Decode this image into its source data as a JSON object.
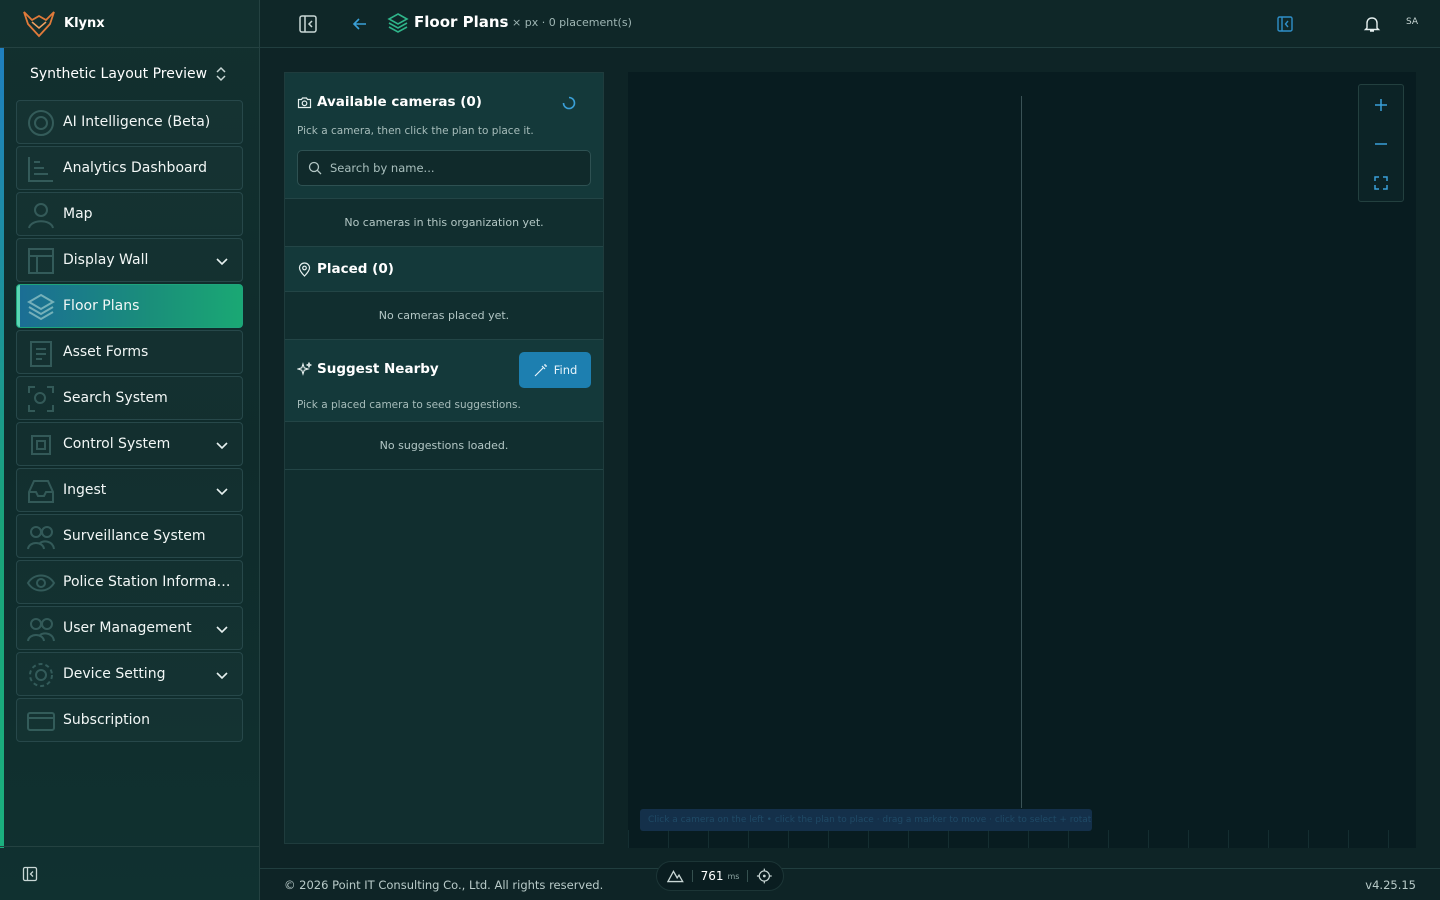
{
  "app": {
    "name": "Klynx"
  },
  "org": {
    "name": "Synthetic Layout Preview"
  },
  "nav": {
    "items": [
      {
        "label": "AI Intelligence (Beta)"
      },
      {
        "label": "Analytics Dashboard"
      },
      {
        "label": "Map"
      },
      {
        "label": "Display Wall"
      },
      {
        "label": "Floor Plans"
      },
      {
        "label": "Asset Forms"
      },
      {
        "label": "Search System"
      },
      {
        "label": "Control System"
      },
      {
        "label": "Ingest"
      },
      {
        "label": "Surveillance System"
      },
      {
        "label": "Police Station Informati..."
      },
      {
        "label": "User Management"
      },
      {
        "label": "Device Setting"
      },
      {
        "label": "Subscription"
      }
    ]
  },
  "header": {
    "title": "Floor Plans",
    "subtitle": "· × px · 0 placement(s)",
    "avatar": "SA"
  },
  "available": {
    "title": "Available cameras (0)",
    "description": "Pick a camera, then click the plan to place it.",
    "search_placeholder": "Search by name...",
    "empty": "No cameras in this organization yet."
  },
  "placed": {
    "title": "Placed (0)",
    "empty": "No cameras placed yet."
  },
  "suggest": {
    "title": "Suggest Nearby",
    "find_label": "Find",
    "description": "Pick a placed camera to seed suggestions.",
    "empty": "No suggestions loaded."
  },
  "canvas": {
    "hint": "Click a camera on the left • click the plan to place · drag a marker to move · click to select + rotate"
  },
  "footer": {
    "copyright": "© 2026 Point IT Consulting Co., Ltd. All rights reserved.",
    "version": "v4.25.15",
    "latency_value": "761",
    "latency_unit": "ms"
  },
  "colors": {
    "accent_blue": "#1d7fb0",
    "accent_green": "#1aa874",
    "background": "#0e2426"
  }
}
